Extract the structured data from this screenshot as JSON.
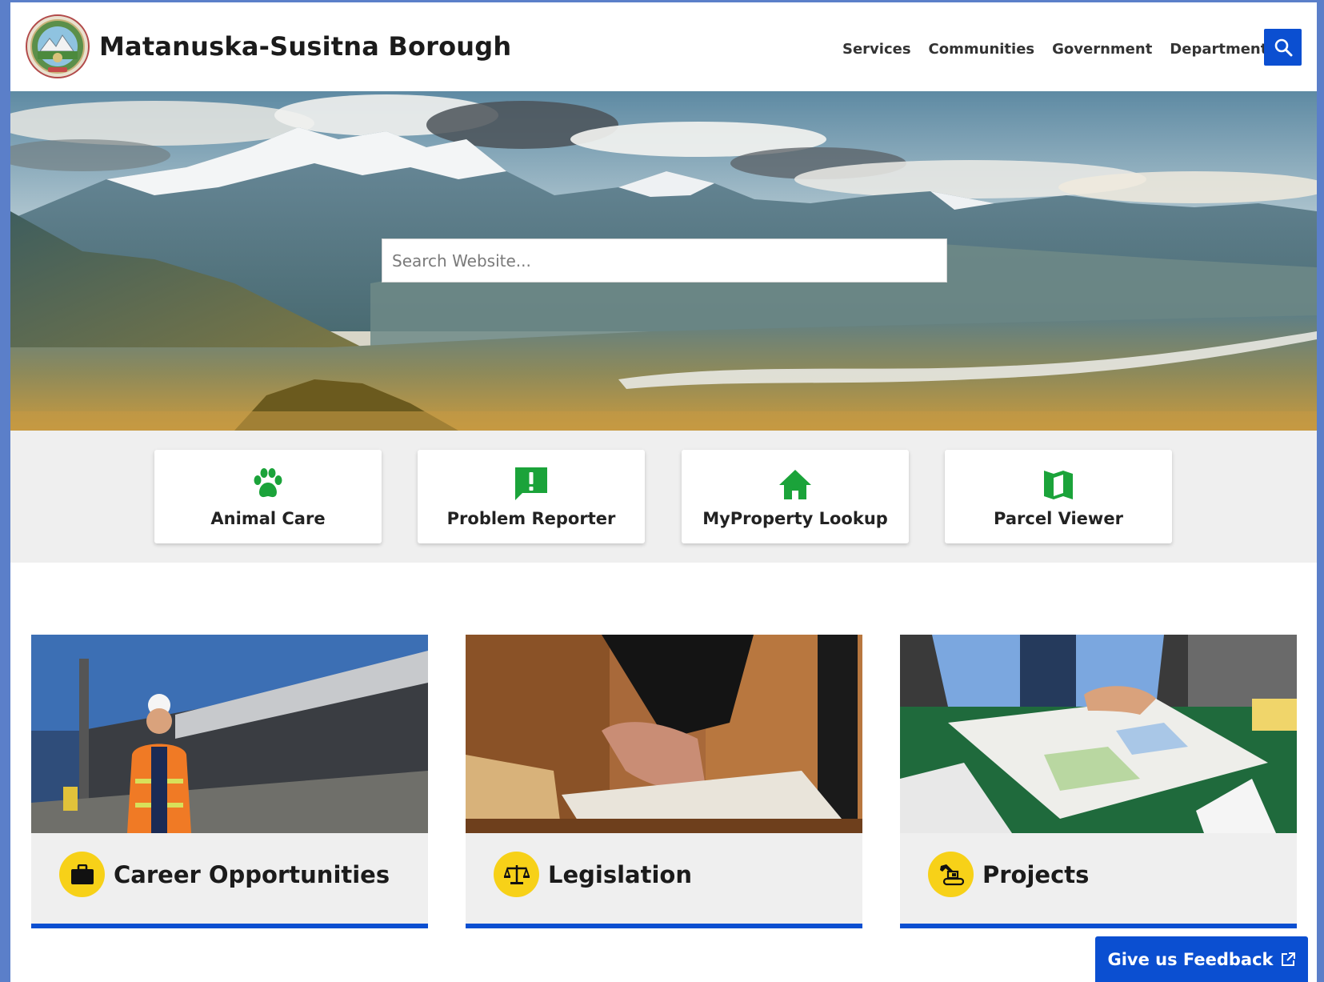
{
  "header": {
    "site_title": "Matanuska-Susitna Borough",
    "nav": [
      "Services",
      "Communities",
      "Government",
      "Departments"
    ]
  },
  "hero": {
    "search_placeholder": "Search Website..."
  },
  "quick_links": [
    {
      "label": "Animal Care",
      "icon": "paw-icon"
    },
    {
      "label": "Problem Reporter",
      "icon": "alert-message-icon"
    },
    {
      "label": "MyProperty Lookup",
      "icon": "home-icon"
    },
    {
      "label": "Parcel Viewer",
      "icon": "map-icon"
    }
  ],
  "features": [
    {
      "title": "Career Opportunities",
      "icon": "briefcase-icon"
    },
    {
      "title": "Legislation",
      "icon": "scales-icon"
    },
    {
      "title": "Projects",
      "icon": "excavator-icon"
    }
  ],
  "feedback": {
    "label": "Give us Feedback",
    "icon": "external-link-icon"
  },
  "colors": {
    "brand_blue": "#0b4fd1",
    "icon_green": "#1ba33a",
    "badge_yellow": "#f7d118",
    "band_gray": "#efefef"
  }
}
